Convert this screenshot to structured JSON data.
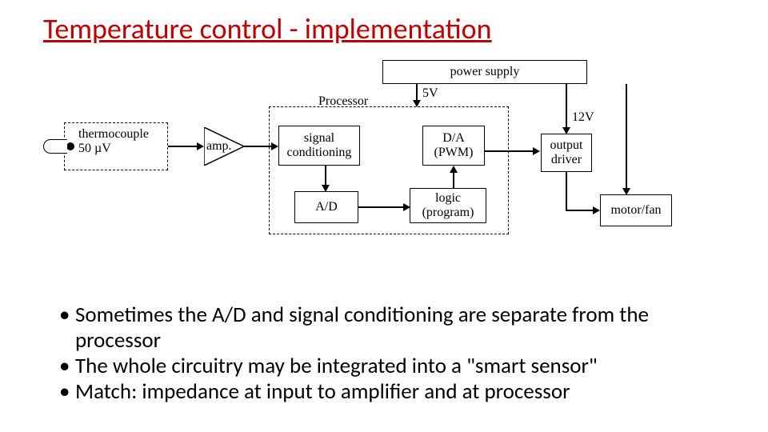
{
  "title": "Temperature control - implementation",
  "diagram": {
    "thermocouple": {
      "line1": "thermocouple",
      "line2": "50 µV"
    },
    "amp": "amp.",
    "processor_label": "Processor",
    "signal_conditioning": {
      "line1": "signal",
      "line2": "conditioning"
    },
    "ad": "A/D",
    "da": {
      "line1": "D/A",
      "line2": "(PWM)"
    },
    "logic": {
      "line1": "logic",
      "line2": "(program)"
    },
    "power_supply": "power supply",
    "output_driver": {
      "line1": "output",
      "line2": "driver"
    },
    "motor_fan": "motor/fan",
    "v5": "5V",
    "v12": "12V"
  },
  "bullets": [
    "Sometimes the A/D and signal conditioning are separate from the processor",
    "The whole circuitry may be integrated into a \"smart sensor\"",
    "Match: impedance at input to amplifier and at processor"
  ]
}
